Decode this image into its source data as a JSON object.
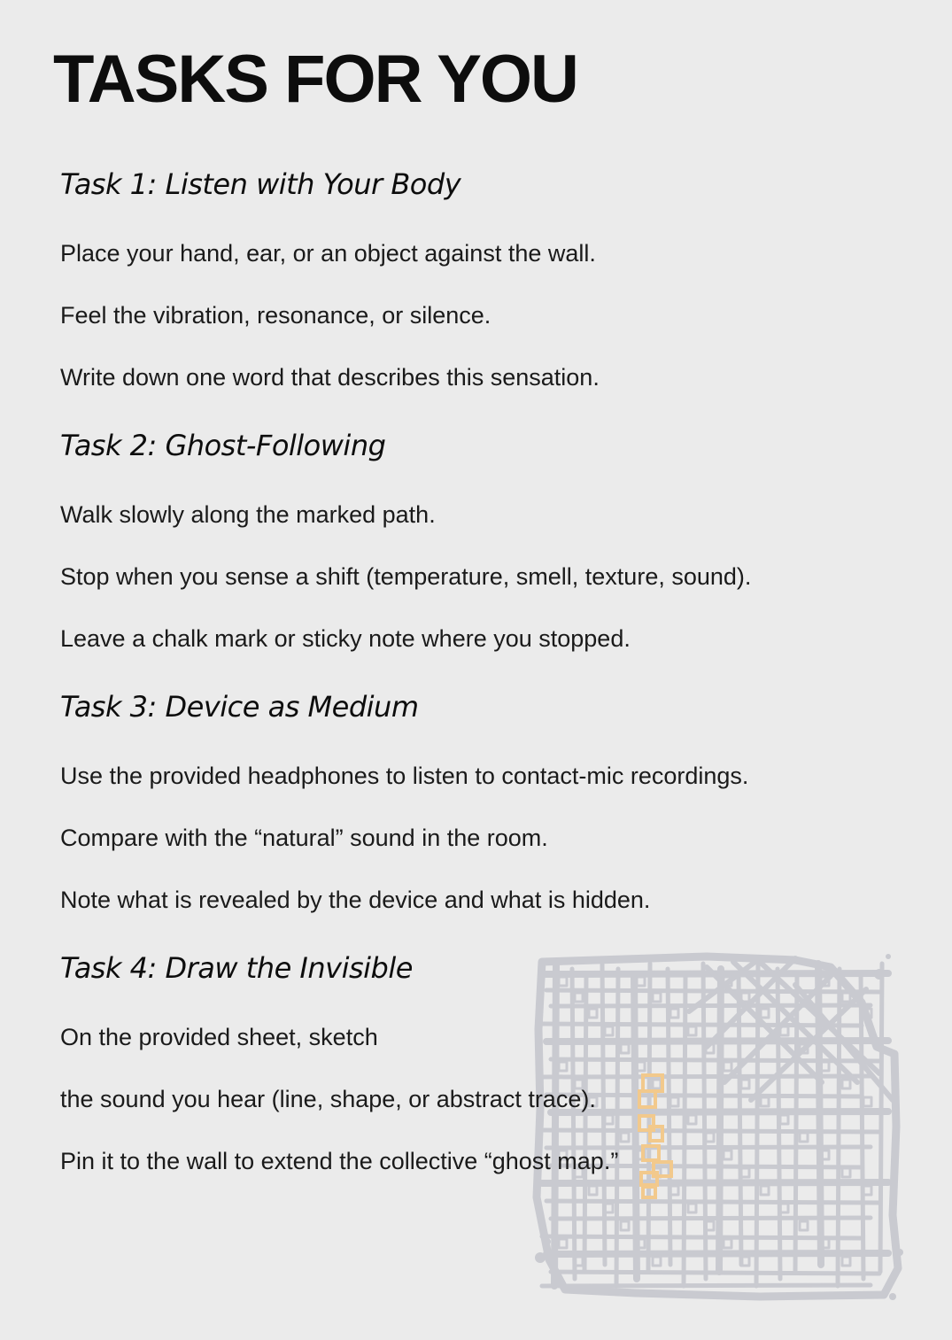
{
  "title": "TASKS FOR YOU",
  "tasks": [
    {
      "heading": "Task 1: Listen with Your Body",
      "lines": [
        "Place your hand, ear, or an object against the wall.",
        "Feel the vibration, resonance, or silence.",
        "Write down one word that describes this sensation."
      ]
    },
    {
      "heading": "Task 2: Ghost-Following",
      "lines": [
        "Walk slowly along the marked path.",
        "Stop when you sense a shift (temperature, smell, texture, sound).",
        "Leave a chalk mark or sticky note where you stopped."
      ]
    },
    {
      "heading": "Task 3: Device as Medium",
      "lines": [
        "Use the provided headphones to listen to contact-mic recordings.",
        "Compare with the “natural” sound in the room.",
        "Note what is revealed by the device and what is hidden."
      ]
    },
    {
      "heading": "Task 4: Draw the Invisible",
      "lines": [
        "On the provided sheet, sketch",
        "the sound you hear (line, shape, or abstract trace).",
        "Pin it to the wall to extend the collective “ghost map.”"
      ]
    }
  ],
  "colors": {
    "background": "#ebebeb",
    "text": "#111111",
    "map_streets": "#c9cad0",
    "map_path": "#f2c98c"
  }
}
